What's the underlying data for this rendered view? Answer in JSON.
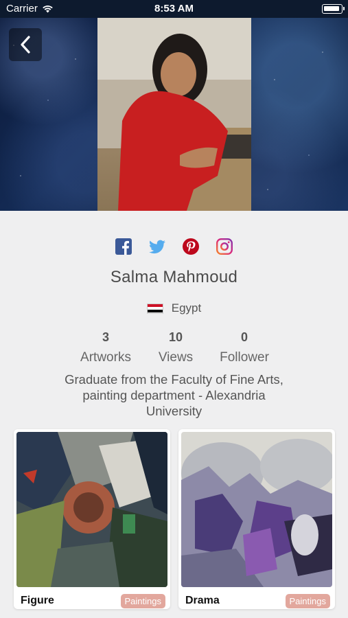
{
  "status_bar": {
    "carrier": "Carrier",
    "time": "8:53 AM"
  },
  "header": {
    "back_icon": "chevron-left-icon"
  },
  "social": [
    {
      "name": "facebook",
      "icon": "facebook-icon",
      "color": "#3b5998"
    },
    {
      "name": "twitter",
      "icon": "twitter-icon",
      "color": "#55acee"
    },
    {
      "name": "pinterest",
      "icon": "pinterest-icon",
      "color": "#bd081c"
    },
    {
      "name": "instagram",
      "icon": "instagram-icon",
      "color": "#c13584"
    }
  ],
  "profile": {
    "name": "Salma Mahmoud",
    "country": "Egypt",
    "flag_colors": [
      "#ce1126",
      "#ffffff",
      "#000000"
    ],
    "stats": [
      {
        "value": "3",
        "label": "Artworks"
      },
      {
        "value": "10",
        "label": "Views"
      },
      {
        "value": "0",
        "label": "Follower"
      }
    ],
    "bio": "Graduate from the Faculty of Fine Arts, painting department - Alexandria University"
  },
  "artworks": [
    {
      "title": "Figure",
      "category": "Paintings"
    },
    {
      "title": "Drama",
      "category": "Paintings"
    }
  ],
  "colors": {
    "background": "#efeff0",
    "badge": "#e2a79d"
  }
}
